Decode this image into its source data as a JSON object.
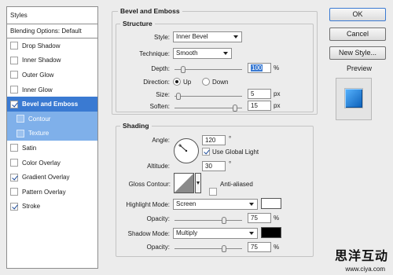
{
  "styles_panel": {
    "header": "Styles",
    "blending_options": "Blending Options: Default",
    "items": [
      {
        "label": "Drop Shadow",
        "checked": false
      },
      {
        "label": "Inner Shadow",
        "checked": false
      },
      {
        "label": "Outer Glow",
        "checked": false
      },
      {
        "label": "Inner Glow",
        "checked": false
      },
      {
        "label": "Bevel and Emboss",
        "checked": true,
        "active": true
      },
      {
        "label": "Contour",
        "checked": false,
        "sub": true
      },
      {
        "label": "Texture",
        "checked": false,
        "sub": true
      },
      {
        "label": "Satin",
        "checked": false
      },
      {
        "label": "Color Overlay",
        "checked": false
      },
      {
        "label": "Gradient Overlay",
        "checked": true
      },
      {
        "label": "Pattern Overlay",
        "checked": false
      },
      {
        "label": "Stroke",
        "checked": true
      }
    ]
  },
  "bevel": {
    "title": "Bevel and Emboss",
    "structure_title": "Structure",
    "style_label": "Style:",
    "style_value": "Inner Bevel",
    "technique_label": "Technique:",
    "technique_value": "Smooth",
    "depth_label": "Depth:",
    "depth_value": "100",
    "depth_unit": "%",
    "depth_level": 0.1,
    "direction_label": "Direction:",
    "direction_up": "Up",
    "direction_down": "Down",
    "direction_selected": "Up",
    "size_label": "Size:",
    "size_value": "5",
    "size_unit": "px",
    "size_level": 0.02,
    "soften_label": "Soften:",
    "soften_value": "15",
    "soften_unit": "px",
    "soften_level": 0.93
  },
  "shading": {
    "title": "Shading",
    "angle_label": "Angle:",
    "angle_value": "120",
    "angle_unit": "°",
    "global_light_label": "Use Global Light",
    "global_light_checked": true,
    "altitude_label": "Altitude:",
    "altitude_value": "30",
    "altitude_unit": "°",
    "gloss_label": "Gloss Contour:",
    "anti_aliased_label": "Anti-aliased",
    "anti_aliased_checked": false,
    "highlight_mode_label": "Highlight Mode:",
    "highlight_mode_value": "Screen",
    "highlight_color": "#ffffff",
    "highlight_opacity_label": "Opacity:",
    "highlight_opacity_value": "75",
    "highlight_opacity_unit": "%",
    "highlight_opacity_level": 0.75,
    "shadow_mode_label": "Shadow Mode:",
    "shadow_mode_value": "Multiply",
    "shadow_color": "#000000",
    "shadow_opacity_label": "Opacity:",
    "shadow_opacity_value": "75",
    "shadow_opacity_unit": "%",
    "shadow_opacity_level": 0.75
  },
  "buttons": {
    "ok": "OK",
    "cancel": "Cancel",
    "new_style": "New Style...",
    "preview_label": "Preview",
    "preview_checked": true
  },
  "colors": {
    "accent": "#3a7ad2",
    "preview_swatch": "#1e7fd8"
  },
  "watermark": {
    "cn": "思洋互动",
    "url": "www.ciya.com"
  }
}
